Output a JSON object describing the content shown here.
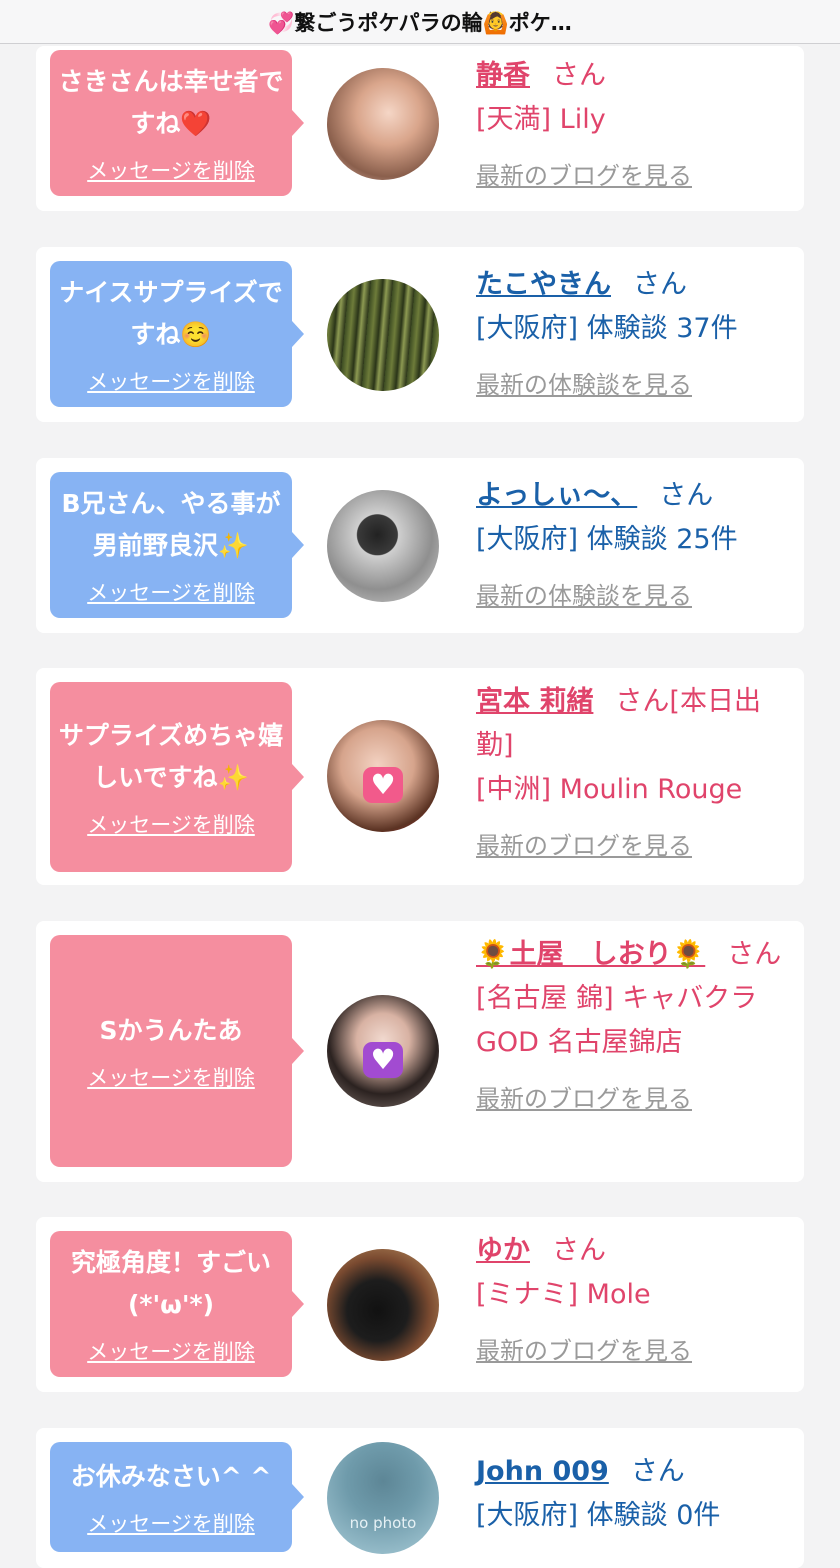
{
  "page_title": "💞繋ごうポケパラの輪🙆ポケ…",
  "common": {
    "delete_label": "メッセージを削除",
    "san": "さん"
  },
  "cards": [
    {
      "message": "さきさんは幸せ者ですね❤️",
      "bubble_color": "pink",
      "name": "静香",
      "name_suffix": "さん",
      "shop": "[天満] Lily",
      "latest": "最新のブログを見る",
      "avatar_icon": "photo-avatar"
    },
    {
      "message": "ナイスサプライズですね☺️",
      "bubble_color": "blue",
      "name": "たこやきん",
      "name_suffix": "さん",
      "shop": "[大阪府] 体験談 37件",
      "latest": "最新の体験談を見る",
      "avatar_icon": "photo-avatar"
    },
    {
      "message": "B兄さん、やる事が男前野良沢✨",
      "bubble_color": "blue",
      "name": "よっしぃ〜、",
      "name_suffix": "さん",
      "shop": "[大阪府] 体験談 25件",
      "latest": "最新の体験談を見る",
      "avatar_icon": "photo-avatar"
    },
    {
      "message": "サプライズめちゃ嬉しいですね✨",
      "bubble_color": "pink",
      "name": "宮本 莉緒",
      "name_suffix": "さん[本日出勤]",
      "shop": "[中洲] Moulin Rouge",
      "latest": "最新のブログを見る",
      "avatar_icon": "photo-avatar"
    },
    {
      "message": "Sかうんたあ",
      "bubble_color": "pink",
      "name": "🌻土屋　しおり🌻",
      "name_suffix": "さん",
      "shop": "[名古屋 錦] キャバクラGOD 名古屋錦店",
      "latest": "最新のブログを見る",
      "avatar_icon": "photo-avatar"
    },
    {
      "message": "究極角度！すごい(*'ω'*)",
      "bubble_color": "pink",
      "name": "ゆか",
      "name_suffix": "さん",
      "shop": "[ミナミ] Mole",
      "latest": "最新のブログを見る",
      "avatar_icon": "photo-avatar"
    },
    {
      "message": "お休みなさい^ ^",
      "bubble_color": "blue",
      "name": "John 009",
      "name_suffix": "さん",
      "shop": "[大阪府] 体験談 0件",
      "latest": "",
      "avatar_text": "no photo",
      "avatar_icon": "no-photo-avatar"
    }
  ],
  "colors": {
    "pink_bubble": "#f58e9f",
    "blue_bubble": "#87b3f3",
    "pink_text": "#e0446b",
    "blue_text": "#1a60a8"
  }
}
